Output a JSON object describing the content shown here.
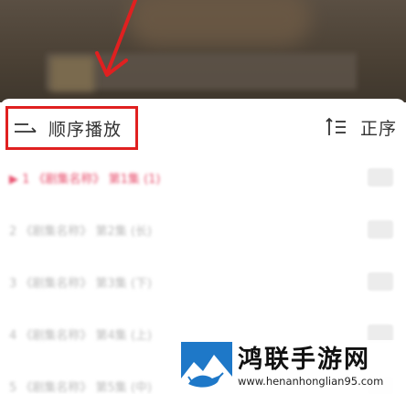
{
  "header": {
    "play_mode_label": "顺序播放",
    "play_mode_icon": "sequential-play-icon",
    "sort_label": "正序",
    "sort_icon": "sort-ascending-icon",
    "highlight_color": "#e02020"
  },
  "episodes": [
    {
      "label": "▶ 1  《剧集名称》 第1集 (1)",
      "active": true
    },
    {
      "label": "2  《剧集名称》 第2集 (长)",
      "active": false
    },
    {
      "label": "3  《剧集名称》 第3集 (下)",
      "active": false
    },
    {
      "label": "4  《剧集名称》 第4集 (上)",
      "active": false
    },
    {
      "label": "5  《剧集名称》 第5集 (中)",
      "active": false
    }
  ],
  "watermark": {
    "name": "鸿联手游网",
    "url": "www.henanhonglian95.com"
  },
  "colors": {
    "active_episode": "#e8506e",
    "arrow": "#e02020"
  }
}
